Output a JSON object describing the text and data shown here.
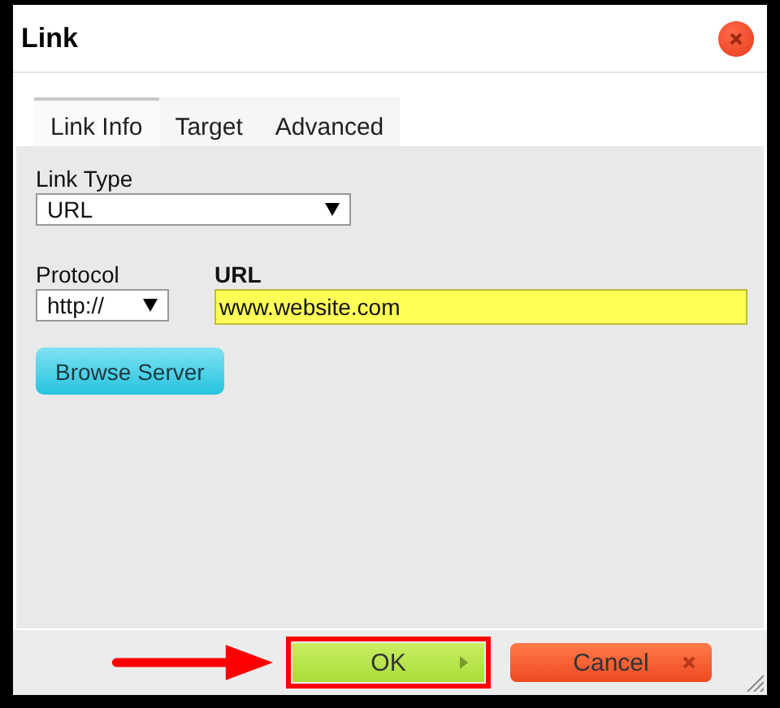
{
  "window": {
    "title": "Link"
  },
  "tabs": [
    {
      "label": "Link Info",
      "selected": true
    },
    {
      "label": "Target",
      "selected": false
    },
    {
      "label": "Advanced",
      "selected": false
    }
  ],
  "link_type": {
    "label": "Link Type",
    "value": "URL"
  },
  "protocol": {
    "label": "Protocol",
    "value": "http://"
  },
  "url": {
    "label": "URL",
    "value": "www.website.com"
  },
  "browse_button": "Browse Server",
  "buttons": [
    {
      "label": "OK",
      "kind": "ok",
      "highlighted": true
    },
    {
      "label": "Cancel",
      "kind": "cancel",
      "highlighted": false
    }
  ]
}
